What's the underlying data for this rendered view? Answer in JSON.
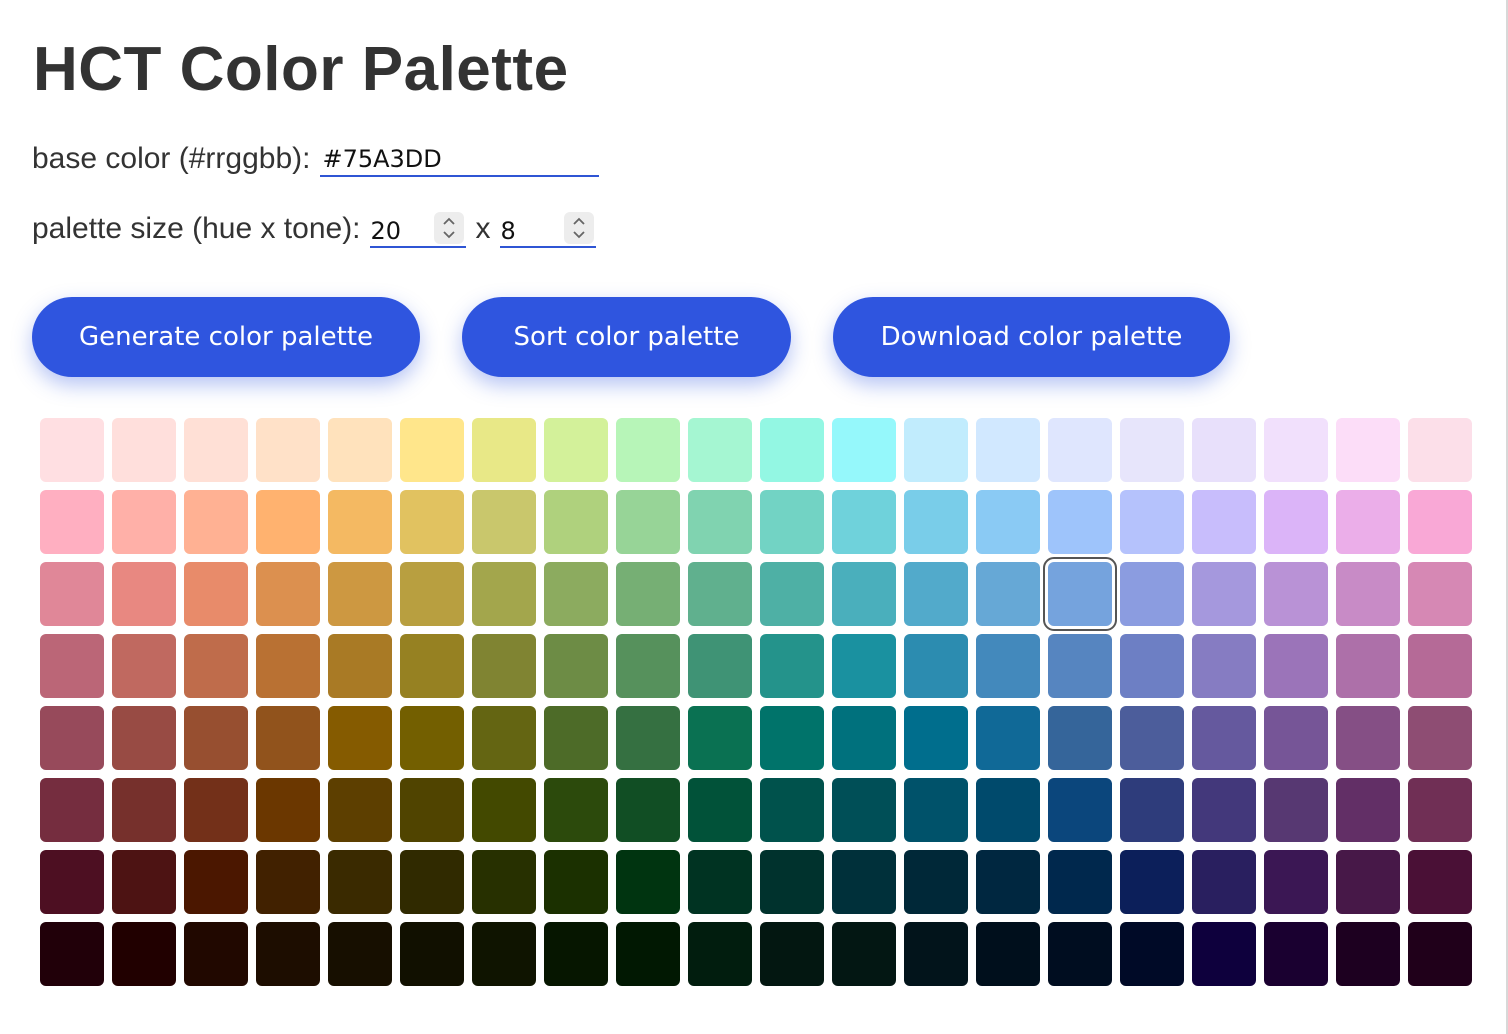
{
  "title": "HCT Color Palette",
  "base_color": {
    "label": "base color (#rrggbb):",
    "value": "#75A3DD"
  },
  "palette_size": {
    "label": "palette size (hue x tone):",
    "hue": "20",
    "separator": "x",
    "tone": "8"
  },
  "buttons": {
    "generate": "Generate color palette",
    "sort": "Sort color palette",
    "download": "Download color palette"
  },
  "colors": {
    "accent": "#2f55df",
    "selected_outline": "#555555"
  },
  "selected": {
    "row": 2,
    "col": 14
  },
  "palette": [
    [
      "#ffdfe2",
      "#ffdfdc",
      "#ffe0d6",
      "#ffe1c8",
      "#ffe2bc",
      "#ffe68b",
      "#e8e887",
      "#d3f19a",
      "#b7f5b8",
      "#a5f6d2",
      "#93f7e3",
      "#95f8fb",
      "#c1ecfd",
      "#d1e8ff",
      "#dfe6fe",
      "#e7e5fb",
      "#e8e0fb",
      "#f1e0fc",
      "#fcddf8",
      "#fcdfe9"
    ],
    [
      "#ffafc1",
      "#ffb0a8",
      "#ffb193",
      "#ffb26f",
      "#f4b962",
      "#e1c260",
      "#c9c76c",
      "#afd17d",
      "#97d497",
      "#80d3b0",
      "#72d3c4",
      "#6fd2db",
      "#79cde9",
      "#8acaf4",
      "#9ec4fb",
      "#b5c2fc",
      "#c8bdfc",
      "#dbb4f8",
      "#ebaee9",
      "#f9a8d6"
    ],
    [
      "#e08798",
      "#e88881",
      "#e88b6a",
      "#dc904f",
      "#cd9841",
      "#b89f40",
      "#a3a64c",
      "#8cab5f",
      "#76af74",
      "#60b08e",
      "#4eb0a5",
      "#4aafbc",
      "#52aacb",
      "#66a8d6",
      "#75a3dd",
      "#8b9ce0",
      "#a598dd",
      "#b992d6",
      "#c88bc6",
      "#d688b4"
    ],
    [
      "#bb6677",
      "#c06960",
      "#bf6c4b",
      "#b97133",
      "#a97a25",
      "#968122",
      "#808432",
      "#6d8c45",
      "#56915c",
      "#3f9375",
      "#24938b",
      "#1a91a0",
      "#2c8cb0",
      "#4389bc",
      "#5685c0",
      "#6d7fc4",
      "#867cc2",
      "#9b74b9",
      "#ad70a9",
      "#b56a97"
    ],
    [
      "#974a5b",
      "#984b44",
      "#974f30",
      "#91531c",
      "#855b00",
      "#735f00",
      "#646512",
      "#4d6b28",
      "#357041",
      "#0a7152",
      "#00736a",
      "#00717d",
      "#006e8d",
      "#106997",
      "#35659a",
      "#4c5d9b",
      "#65599e",
      "#765597",
      "#854f85",
      "#8e4d73"
    ],
    [
      "#752d3f",
      "#76302c",
      "#733019",
      "#6b3700",
      "#5d3f00",
      "#504400",
      "#434900",
      "#2c4a0c",
      "#114e24",
      "#015239",
      "#00524c",
      "#004f57",
      "#00526a",
      "#004a6c",
      "#0b467c",
      "#2e3c7b",
      "#43387b",
      "#573872",
      "#622f66",
      "#702f55"
    ],
    [
      "#4d0f22",
      "#4d1313",
      "#4b1700",
      "#412100",
      "#3a2a00",
      "#302a00",
      "#273000",
      "#1b3000",
      "#003410",
      "#003322",
      "#00322d",
      "#00303a",
      "#002838",
      "#002740",
      "#00284d",
      "#0c1f5a",
      "#291f5f",
      "#3b1754",
      "#471848",
      "#4a1036"
    ],
    [
      "#210009",
      "#210000",
      "#210800",
      "#1d0d00",
      "#170f00",
      "#111000",
      "#0f1400",
      "#061600",
      "#011802",
      "#011d0e",
      "#031711",
      "#031713",
      "#02141b",
      "#000f1c",
      "#000d20",
      "#000a27",
      "#0e003d",
      "#1a0030",
      "#1d0020",
      "#20001a"
    ]
  ]
}
